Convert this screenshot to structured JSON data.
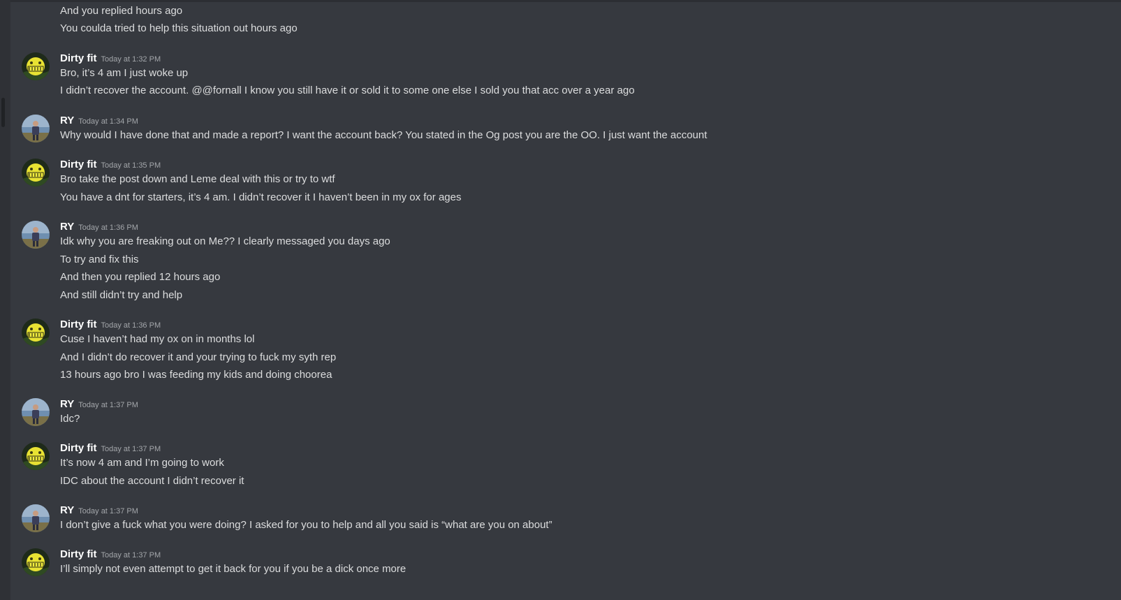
{
  "colors": {
    "background": "#36393f",
    "text": "#dcddde",
    "username": "#ffffff",
    "timestamp": "#a3a6aa"
  },
  "continuation": [
    "And you replied hours ago",
    "You coulda tried to help this situation out hours ago"
  ],
  "messages": [
    {
      "author": "Dirty fit",
      "avatar_icon": "dirty-fit-avatar-icon",
      "time": "Today at 1:32 PM",
      "lines": [
        "Bro, it’s 4 am I just woke up",
        "I didn’t recover the account. @@fornall I know you still have it or sold it to some one else I sold you that acc over a year ago"
      ]
    },
    {
      "author": "RY",
      "avatar_icon": "ry-avatar-icon",
      "time": "Today at 1:34 PM",
      "lines": [
        "Why would I have done that and made a report? I want the account back? You stated in the Og post you are the OO. I just want the account"
      ]
    },
    {
      "author": "Dirty fit",
      "avatar_icon": "dirty-fit-avatar-icon",
      "time": "Today at 1:35 PM",
      "lines": [
        "Bro take the post down and Leme deal with this or try to wtf",
        "You have a dnt for starters, it’s 4 am.  I didn’t recover it I haven’t been in my ox for ages"
      ]
    },
    {
      "author": "RY",
      "avatar_icon": "ry-avatar-icon",
      "time": "Today at 1:36 PM",
      "lines": [
        "Idk why you are freaking out on Me?? I clearly messaged you days ago",
        "To try and fix this",
        "And then you replied 12 hours ago",
        "And still didn’t try and help"
      ]
    },
    {
      "author": "Dirty fit",
      "avatar_icon": "dirty-fit-avatar-icon",
      "time": "Today at 1:36 PM",
      "lines": [
        "Cuse I haven’t had my ox on in months lol",
        "And I didn’t do recover it and your trying to fuck my syth rep",
        "13 hours ago bro I was feeding my kids and doing choorea"
      ]
    },
    {
      "author": "RY",
      "avatar_icon": "ry-avatar-icon",
      "time": "Today at 1:37 PM",
      "lines": [
        "Idc?"
      ]
    },
    {
      "author": "Dirty fit",
      "avatar_icon": "dirty-fit-avatar-icon",
      "time": "Today at 1:37 PM",
      "lines": [
        "It’s now 4 am and I’m going to work",
        "IDC about the account I didn’t recover it"
      ]
    },
    {
      "author": "RY",
      "avatar_icon": "ry-avatar-icon",
      "time": "Today at 1:37 PM",
      "lines": [
        "I don’t give a fuck what you were doing? I asked for you to help and all you said is “what are you on about”"
      ]
    },
    {
      "author": "Dirty fit",
      "avatar_icon": "dirty-fit-avatar-icon",
      "time": "Today at 1:37 PM",
      "lines": [
        "I’ll simply not even attempt to get it back for you if you be a dick once more"
      ]
    }
  ]
}
